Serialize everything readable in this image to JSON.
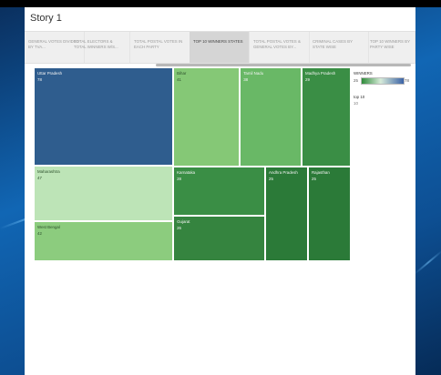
{
  "story": {
    "title": "Story 1"
  },
  "tabs": [
    {
      "label": "GENERAL VOTES DIVIDED BY TVA..."
    },
    {
      "label": "TOTAL ELECTORS & TOTAL WINNERS W/S..."
    },
    {
      "label": "TOTAL POSTAL VOTES IN EACH PARTY"
    },
    {
      "label": "TOP 10 WINNERS STATES",
      "active": true
    },
    {
      "label": "TOTAL POSTAL VOTES & GENERAL VOTES BY..."
    },
    {
      "label": "CRIMINAL CASES BY STATE WISE"
    },
    {
      "label": "TOP 10 WINNERS BY PARTY WISE"
    }
  ],
  "legend": {
    "title": "WINNERS",
    "min": "25",
    "max": "78",
    "sub_title": "top 10",
    "sub_value": "10"
  },
  "chart_data": {
    "type": "treemap",
    "measure": "WINNERS",
    "color_range": [
      25,
      78
    ],
    "items": [
      {
        "state": "Uttar Pradesh",
        "value": 78,
        "color": "#2f5d8e"
      },
      {
        "state": "Maharashtra",
        "value": 47,
        "color": "#bde4b7"
      },
      {
        "state": "West Bengal",
        "value": 42,
        "color": "#8ccc7e"
      },
      {
        "state": "Bihar",
        "value": 41,
        "color": "#85c876"
      },
      {
        "state": "Tamil Nadu",
        "value": 38,
        "color": "#69b866"
      },
      {
        "state": "Madhya Pradesh",
        "value": 29,
        "color": "#3a8e45"
      },
      {
        "state": "Karnataka",
        "value": 28,
        "color": "#3a8e45"
      },
      {
        "state": "Gujarat",
        "value": 26,
        "color": "#35843f"
      },
      {
        "state": "Andhra Pradesh",
        "value": 25,
        "color": "#2b7a38"
      },
      {
        "state": "Rajasthan",
        "value": 25,
        "color": "#2b7a38"
      }
    ]
  }
}
